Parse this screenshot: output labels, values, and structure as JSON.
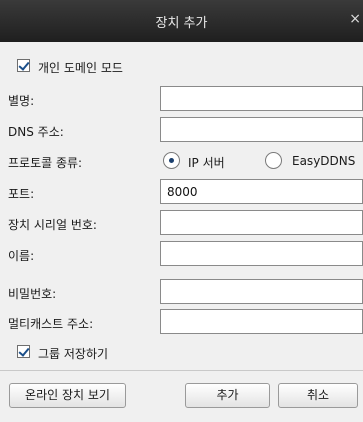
{
  "window": {
    "title": "장치 추가",
    "close_glyph": "×"
  },
  "private_domain": {
    "label": "개인 도메인 모드",
    "checked": true
  },
  "fields": {
    "alias_label": "별명:",
    "alias_value": "",
    "dns_label": "DNS 주소:",
    "dns_value": "",
    "protocol_label": "프로토콜 종류:",
    "port_label": "포트:",
    "port_value": "8000",
    "serial_label": "장치 시리얼 번호:",
    "serial_value": "",
    "name_label": "이름:",
    "name_value": "",
    "password_label": "비밀번호:",
    "password_value": "",
    "multicast_label": "멀티캐스트 주소:",
    "multicast_value": ""
  },
  "protocol_options": [
    {
      "label": "IP 서버",
      "selected": true
    },
    {
      "label": "EasyDDNS",
      "selected": false
    }
  ],
  "group_save": {
    "label": "그룹 저장하기",
    "checked": true
  },
  "buttons": {
    "online_devices": "온라인 장치 보기",
    "add": "추가",
    "cancel": "취소"
  }
}
